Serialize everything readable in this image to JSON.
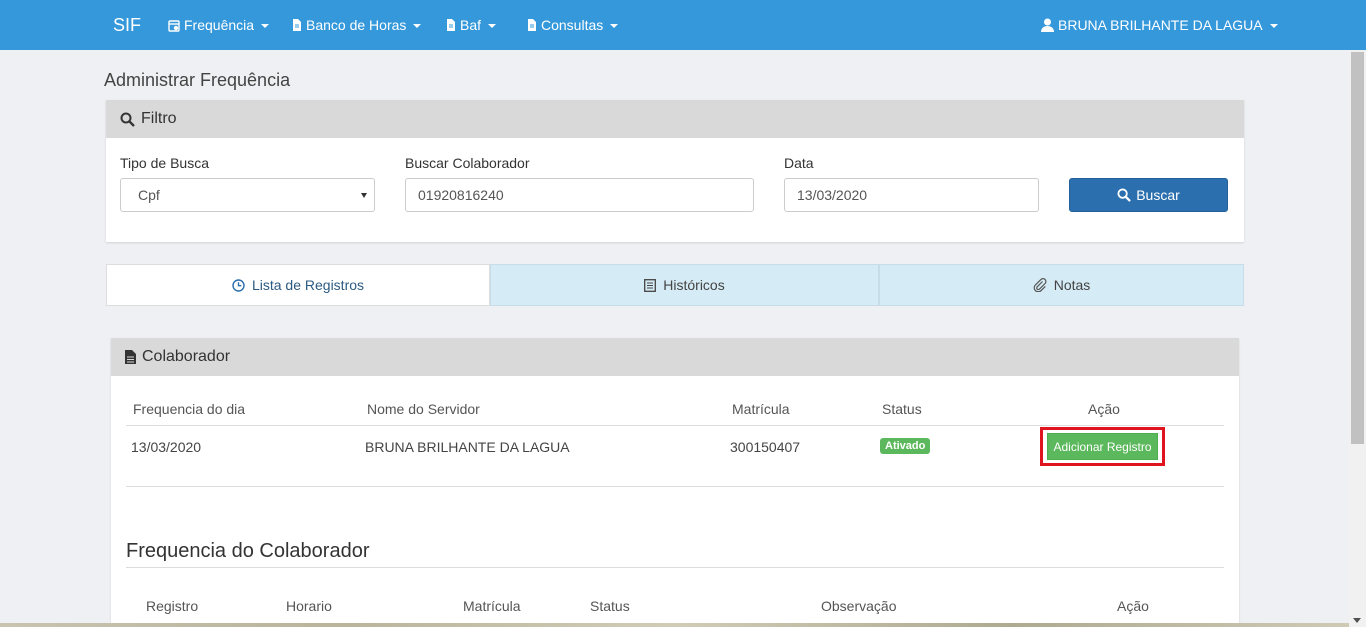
{
  "nav": {
    "brand": "SIF",
    "items": [
      {
        "label": "Frequência",
        "icon": "calendar-clock-icon"
      },
      {
        "label": "Banco de Horas",
        "icon": "document-icon"
      },
      {
        "label": "Baf",
        "icon": "document-icon"
      },
      {
        "label": "Consultas",
        "icon": "document-icon"
      }
    ],
    "user": "BRUNA BRILHANTE DA LAGUA"
  },
  "page_title": "Administrar Frequência",
  "filter": {
    "heading": "Filtro",
    "tipo_label": "Tipo de Busca",
    "tipo_value": "Cpf",
    "colab_label": "Buscar Colaborador",
    "colab_value": "01920816240",
    "data_label": "Data",
    "data_value": "13/03/2020",
    "buscar_label": "Buscar"
  },
  "tabs": [
    {
      "label": "Lista de Registros",
      "icon": "clock-icon",
      "active": true
    },
    {
      "label": "Históricos",
      "icon": "list-icon",
      "active": false
    },
    {
      "label": "Notas",
      "icon": "paperclip-icon",
      "active": false
    }
  ],
  "colaborador": {
    "heading": "Colaborador",
    "headers": [
      "Frequencia do dia",
      "Nome do Servidor",
      "Matrícula",
      "Status",
      "Ação"
    ],
    "row": {
      "date": "13/03/2020",
      "name": "BRUNA BRILHANTE DA LAGUA",
      "matricula": "300150407",
      "status": "Ativado",
      "action": "Adicionar Registro"
    }
  },
  "frequencia": {
    "title": "Frequencia do Colaborador",
    "headers": [
      "Registro",
      "Horario",
      "Matrícula",
      "Status",
      "Observação",
      "Ação"
    ]
  },
  "colors": {
    "navbar": "#3498db",
    "primary_button": "#2b6fae",
    "success": "#5cb85c",
    "highlight": "#e0141e"
  }
}
